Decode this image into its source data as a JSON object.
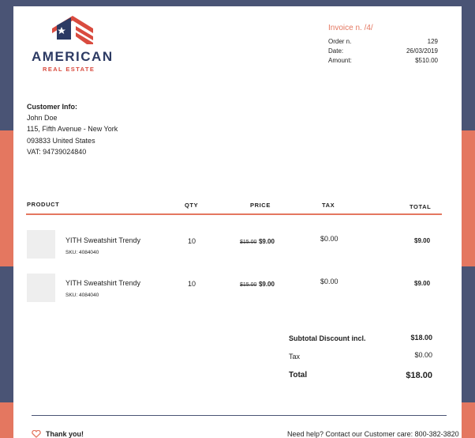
{
  "brand": {
    "name": "AMERICAN",
    "tagline": "REAL ESTATE"
  },
  "invoice": {
    "title": "Invoice n. /4/",
    "order_label": "Order n.",
    "order_value": "129",
    "date_label": "Date:",
    "date_value": "26/03/2019",
    "amount_label": "Amount:",
    "amount_value": "$510.00"
  },
  "customer": {
    "heading": "Customer Info:",
    "name": "John Doe",
    "address": "115, Fifth Avenue - New York",
    "city": "093833 United States",
    "vat": "VAT: 94739024840"
  },
  "table": {
    "headers": {
      "product": "PRODUCT",
      "qty": "QTY",
      "price": "PRICE",
      "tax": "TAX",
      "total": "TOTAL"
    },
    "rows": [
      {
        "name": "YITH Sweatshirt Trendy",
        "sku": "SKU: 4084040",
        "qty": "10",
        "old_price": "$15.00",
        "price": "$9.00",
        "tax": "$0.00",
        "total": "$9.00"
      },
      {
        "name": "YITH Sweatshirt Trendy",
        "sku": "SKU: 4084040",
        "qty": "10",
        "old_price": "$15.00",
        "price": "$9.00",
        "tax": "$0.00",
        "total": "$9.00"
      }
    ]
  },
  "totals": {
    "subtotal_label": "Subtotal Discount incl.",
    "subtotal_value": "$18.00",
    "tax_label": "Tax",
    "tax_value": "$0.00",
    "total_label": "Total",
    "total_value": "$18.00"
  },
  "footer": {
    "thanks": "Thank you!",
    "help": "Need help? Contact our Customer care: 800-382-3820"
  },
  "colors": {
    "navy": "#4a5475",
    "coral": "#e47760",
    "brand_navy": "#2c3a63",
    "brand_red": "#d94b3f"
  }
}
